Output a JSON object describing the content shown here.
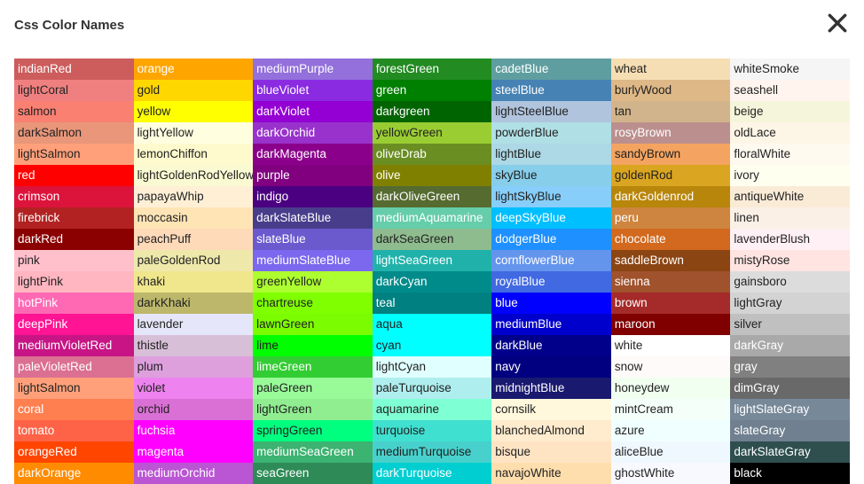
{
  "title": "Css Color Names",
  "columns": [
    [
      {
        "name": "indianRed",
        "bg": "#CD5C5C",
        "t": "light"
      },
      {
        "name": "lightCoral",
        "bg": "#F08080",
        "t": "dark"
      },
      {
        "name": "salmon",
        "bg": "#FA8072",
        "t": "dark"
      },
      {
        "name": "darkSalmon",
        "bg": "#E9967A",
        "t": "dark"
      },
      {
        "name": "lightSalmon",
        "bg": "#FFA07A",
        "t": "dark"
      },
      {
        "name": "red",
        "bg": "#FF0000",
        "t": "light"
      },
      {
        "name": "crimson",
        "bg": "#DC143C",
        "t": "light"
      },
      {
        "name": "firebrick",
        "bg": "#B22222",
        "t": "light"
      },
      {
        "name": "darkRed",
        "bg": "#8B0000",
        "t": "light"
      },
      {
        "name": "pink",
        "bg": "#FFC0CB",
        "t": "dark"
      },
      {
        "name": "lightPink",
        "bg": "#FFB6C1",
        "t": "dark"
      },
      {
        "name": "hotPink",
        "bg": "#FF69B4",
        "t": "light"
      },
      {
        "name": "deepPink",
        "bg": "#FF1493",
        "t": "light"
      },
      {
        "name": "mediumVioletRed",
        "bg": "#C71585",
        "t": "light"
      },
      {
        "name": "paleVioletRed",
        "bg": "#DB7093",
        "t": "light"
      },
      {
        "name": "lightSalmon",
        "bg": "#FFA07A",
        "t": "dark"
      },
      {
        "name": "coral",
        "bg": "#FF7F50",
        "t": "light"
      },
      {
        "name": "tomato",
        "bg": "#FF6347",
        "t": "light"
      },
      {
        "name": "orangeRed",
        "bg": "#FF4500",
        "t": "light"
      },
      {
        "name": "darkOrange",
        "bg": "#FF8C00",
        "t": "light"
      }
    ],
    [
      {
        "name": "orange",
        "bg": "#FFA500",
        "t": "light"
      },
      {
        "name": "gold",
        "bg": "#FFD700",
        "t": "dark"
      },
      {
        "name": "yellow",
        "bg": "#FFFF00",
        "t": "dark"
      },
      {
        "name": "lightYellow",
        "bg": "#FFFFE0",
        "t": "dark"
      },
      {
        "name": "lemonChiffon",
        "bg": "#FFFACD",
        "t": "dark"
      },
      {
        "name": "lightGoldenRodYellow",
        "bg": "#FAFAD2",
        "t": "dark"
      },
      {
        "name": "papayaWhip",
        "bg": "#FFEFD5",
        "t": "dark"
      },
      {
        "name": "moccasin",
        "bg": "#FFE4B5",
        "t": "dark"
      },
      {
        "name": "peachPuff",
        "bg": "#FFDAB9",
        "t": "dark"
      },
      {
        "name": "paleGoldenRod",
        "bg": "#EEE8AA",
        "t": "dark"
      },
      {
        "name": "khaki",
        "bg": "#F0E68C",
        "t": "dark"
      },
      {
        "name": "darkKhaki",
        "bg": "#BDB76B",
        "t": "dark"
      },
      {
        "name": "lavender",
        "bg": "#E6E6FA",
        "t": "dark"
      },
      {
        "name": "thistle",
        "bg": "#D8BFD8",
        "t": "dark"
      },
      {
        "name": "plum",
        "bg": "#DDA0DD",
        "t": "dark"
      },
      {
        "name": "violet",
        "bg": "#EE82EE",
        "t": "dark"
      },
      {
        "name": "orchid",
        "bg": "#DA70D6",
        "t": "dark"
      },
      {
        "name": "fuchsia",
        "bg": "#FF00FF",
        "t": "light"
      },
      {
        "name": "magenta",
        "bg": "#FF00FF",
        "t": "light"
      },
      {
        "name": "mediumOrchid",
        "bg": "#BA55D3",
        "t": "light"
      }
    ],
    [
      {
        "name": "mediumPurple",
        "bg": "#9370DB",
        "t": "light"
      },
      {
        "name": "blueViolet",
        "bg": "#8A2BE2",
        "t": "light"
      },
      {
        "name": "darkViolet",
        "bg": "#9400D3",
        "t": "light"
      },
      {
        "name": "darkOrchid",
        "bg": "#9932CC",
        "t": "light"
      },
      {
        "name": "darkMagenta",
        "bg": "#8B008B",
        "t": "light"
      },
      {
        "name": "purple",
        "bg": "#800080",
        "t": "light"
      },
      {
        "name": "indigo",
        "bg": "#4B0082",
        "t": "light"
      },
      {
        "name": "darkSlateBlue",
        "bg": "#483D8B",
        "t": "light"
      },
      {
        "name": "slateBlue",
        "bg": "#6A5ACD",
        "t": "light"
      },
      {
        "name": "mediumSlateBlue",
        "bg": "#7B68EE",
        "t": "light"
      },
      {
        "name": "greenYellow",
        "bg": "#ADFF2F",
        "t": "dark"
      },
      {
        "name": "chartreuse",
        "bg": "#7FFF00",
        "t": "dark"
      },
      {
        "name": "lawnGreen",
        "bg": "#7CFC00",
        "t": "dark"
      },
      {
        "name": "lime",
        "bg": "#00FF00",
        "t": "dark"
      },
      {
        "name": "limeGreen",
        "bg": "#32CD32",
        "t": "light"
      },
      {
        "name": "paleGreen",
        "bg": "#98FB98",
        "t": "dark"
      },
      {
        "name": "lightGreen",
        "bg": "#90EE90",
        "t": "dark"
      },
      {
        "name": "springGreen",
        "bg": "#00FF7F",
        "t": "dark"
      },
      {
        "name": "mediumSeaGreen",
        "bg": "#3CB371",
        "t": "light"
      },
      {
        "name": "seaGreen",
        "bg": "#2E8B57",
        "t": "light"
      }
    ],
    [
      {
        "name": "forestGreen",
        "bg": "#228B22",
        "t": "light"
      },
      {
        "name": "green",
        "bg": "#008000",
        "t": "light"
      },
      {
        "name": "darkgreen",
        "bg": "#006400",
        "t": "light"
      },
      {
        "name": "yellowGreen",
        "bg": "#9ACD32",
        "t": "dark"
      },
      {
        "name": "oliveDrab",
        "bg": "#6B8E23",
        "t": "light"
      },
      {
        "name": "olive",
        "bg": "#808000",
        "t": "light"
      },
      {
        "name": "darkOliveGreen",
        "bg": "#556B2F",
        "t": "light"
      },
      {
        "name": "mediumAquamarine",
        "bg": "#66CDAA",
        "t": "light"
      },
      {
        "name": "darkSeaGreen",
        "bg": "#8FBC8F",
        "t": "dark"
      },
      {
        "name": "lightSeaGreen",
        "bg": "#20B2AA",
        "t": "light"
      },
      {
        "name": "darkCyan",
        "bg": "#008B8B",
        "t": "light"
      },
      {
        "name": "teal",
        "bg": "#008080",
        "t": "light"
      },
      {
        "name": "aqua",
        "bg": "#00FFFF",
        "t": "dark"
      },
      {
        "name": "cyan",
        "bg": "#00FFFF",
        "t": "dark"
      },
      {
        "name": "lightCyan",
        "bg": "#E0FFFF",
        "t": "dark"
      },
      {
        "name": "paleTurquoise",
        "bg": "#AFEEEE",
        "t": "dark"
      },
      {
        "name": "aquamarine",
        "bg": "#7FFFD4",
        "t": "dark"
      },
      {
        "name": "turquoise",
        "bg": "#40E0D0",
        "t": "dark"
      },
      {
        "name": "mediumTurquoise",
        "bg": "#48D1CC",
        "t": "dark"
      },
      {
        "name": "darkTurquoise",
        "bg": "#00CED1",
        "t": "light"
      }
    ],
    [
      {
        "name": "cadetBlue",
        "bg": "#5F9EA0",
        "t": "light"
      },
      {
        "name": "steelBlue",
        "bg": "#4682B4",
        "t": "light"
      },
      {
        "name": "lightSteelBlue",
        "bg": "#B0C4DE",
        "t": "dark"
      },
      {
        "name": "powderBlue",
        "bg": "#B0E0E6",
        "t": "dark"
      },
      {
        "name": "lightBlue",
        "bg": "#ADD8E6",
        "t": "dark"
      },
      {
        "name": "skyBlue",
        "bg": "#87CEEB",
        "t": "dark"
      },
      {
        "name": "lightSkyBlue",
        "bg": "#87CEFA",
        "t": "dark"
      },
      {
        "name": "deepSkyBlue",
        "bg": "#00BFFF",
        "t": "light"
      },
      {
        "name": "dodgerBlue",
        "bg": "#1E90FF",
        "t": "light"
      },
      {
        "name": "cornflowerBlue",
        "bg": "#6495ED",
        "t": "light"
      },
      {
        "name": "royalBlue",
        "bg": "#4169E1",
        "t": "light"
      },
      {
        "name": "blue",
        "bg": "#0000FF",
        "t": "light"
      },
      {
        "name": "mediumBlue",
        "bg": "#0000CD",
        "t": "light"
      },
      {
        "name": "darkBlue",
        "bg": "#00008B",
        "t": "light"
      },
      {
        "name": "navy",
        "bg": "#000080",
        "t": "light"
      },
      {
        "name": "midnightBlue",
        "bg": "#191970",
        "t": "light"
      },
      {
        "name": "cornsilk",
        "bg": "#FFF8DC",
        "t": "dark"
      },
      {
        "name": "blanchedAlmond",
        "bg": "#FFEBCD",
        "t": "dark"
      },
      {
        "name": "bisque",
        "bg": "#FFE4C4",
        "t": "dark"
      },
      {
        "name": "navajoWhite",
        "bg": "#FFDEAD",
        "t": "dark"
      }
    ],
    [
      {
        "name": "wheat",
        "bg": "#F5DEB3",
        "t": "dark"
      },
      {
        "name": "burlyWood",
        "bg": "#DEB887",
        "t": "dark"
      },
      {
        "name": "tan",
        "bg": "#D2B48C",
        "t": "dark"
      },
      {
        "name": "rosyBrown",
        "bg": "#BC8F8F",
        "t": "light"
      },
      {
        "name": "sandyBrown",
        "bg": "#F4A460",
        "t": "dark"
      },
      {
        "name": "goldenRod",
        "bg": "#DAA520",
        "t": "dark"
      },
      {
        "name": "darkGoldenrod",
        "bg": "#B8860B",
        "t": "light"
      },
      {
        "name": "peru",
        "bg": "#CD853F",
        "t": "light"
      },
      {
        "name": "chocolate",
        "bg": "#D2691E",
        "t": "light"
      },
      {
        "name": "saddleBrown",
        "bg": "#8B4513",
        "t": "light"
      },
      {
        "name": "sienna",
        "bg": "#A0522D",
        "t": "light"
      },
      {
        "name": "brown",
        "bg": "#A52A2A",
        "t": "light"
      },
      {
        "name": "maroon",
        "bg": "#800000",
        "t": "light"
      },
      {
        "name": "white",
        "bg": "#FFFFFF",
        "t": "dark"
      },
      {
        "name": "snow",
        "bg": "#FFFAFA",
        "t": "dark"
      },
      {
        "name": "honeydew",
        "bg": "#F0FFF0",
        "t": "dark"
      },
      {
        "name": "mintCream",
        "bg": "#F5FFFA",
        "t": "dark"
      },
      {
        "name": "azure",
        "bg": "#F0FFFF",
        "t": "dark"
      },
      {
        "name": "aliceBlue",
        "bg": "#F0F8FF",
        "t": "dark"
      },
      {
        "name": "ghostWhite",
        "bg": "#F8F8FF",
        "t": "dark"
      }
    ],
    [
      {
        "name": "whiteSmoke",
        "bg": "#F5F5F5",
        "t": "dark"
      },
      {
        "name": "seashell",
        "bg": "#FFF5EE",
        "t": "dark"
      },
      {
        "name": "beige",
        "bg": "#F5F5DC",
        "t": "dark"
      },
      {
        "name": "oldLace",
        "bg": "#FDF5E6",
        "t": "dark"
      },
      {
        "name": "floralWhite",
        "bg": "#FFFAF0",
        "t": "dark"
      },
      {
        "name": "ivory",
        "bg": "#FFFFF0",
        "t": "dark"
      },
      {
        "name": "antiqueWhite",
        "bg": "#FAEBD7",
        "t": "dark"
      },
      {
        "name": "linen",
        "bg": "#FAF0E6",
        "t": "dark"
      },
      {
        "name": "lavenderBlush",
        "bg": "#FFF0F5",
        "t": "dark"
      },
      {
        "name": "mistyRose",
        "bg": "#FFE4E1",
        "t": "dark"
      },
      {
        "name": "gainsboro",
        "bg": "#DCDCDC",
        "t": "dark"
      },
      {
        "name": "lightGray",
        "bg": "#D3D3D3",
        "t": "dark"
      },
      {
        "name": "silver",
        "bg": "#C0C0C0",
        "t": "dark"
      },
      {
        "name": "darkGray",
        "bg": "#A9A9A9",
        "t": "light"
      },
      {
        "name": "gray",
        "bg": "#808080",
        "t": "light"
      },
      {
        "name": "dimGray",
        "bg": "#696969",
        "t": "light"
      },
      {
        "name": "lightSlateGray",
        "bg": "#778899",
        "t": "light"
      },
      {
        "name": "slateGray",
        "bg": "#708090",
        "t": "light"
      },
      {
        "name": "darkSlateGray",
        "bg": "#2F4F4F",
        "t": "light"
      },
      {
        "name": "black",
        "bg": "#000000",
        "t": "light"
      }
    ]
  ]
}
